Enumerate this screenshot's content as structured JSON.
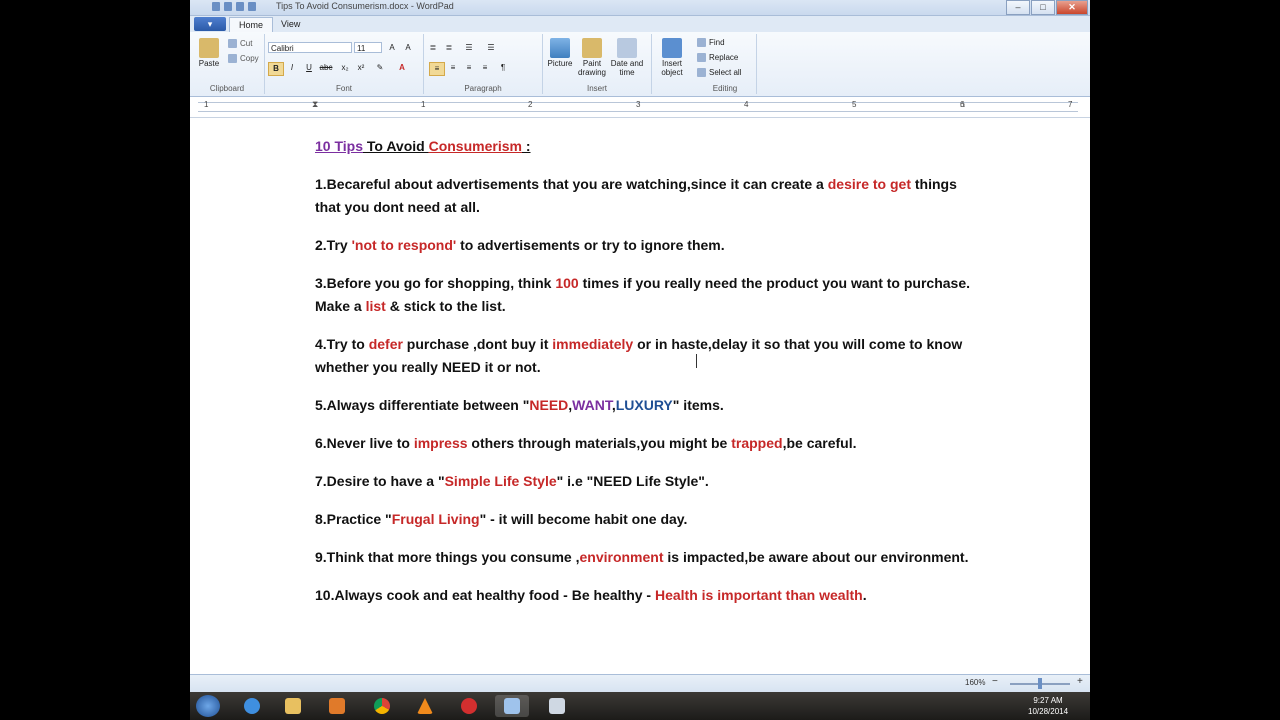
{
  "window": {
    "title": "Tips To Avoid Consumerism.docx - WordPad",
    "controls": {
      "minimize": "–",
      "maximize": "□",
      "close": "✕"
    }
  },
  "tabs": [
    {
      "label": "Home"
    },
    {
      "label": "View"
    }
  ],
  "ribbon": {
    "clipboard": {
      "label": "Clipboard",
      "paste": "Paste",
      "cut": "Cut",
      "copy": "Copy"
    },
    "font": {
      "label": "Font",
      "family": "Calibri",
      "size": "11",
      "bold": "B",
      "italic": "I",
      "underline": "U",
      "strike": "abc"
    },
    "paragraph": {
      "label": "Paragraph"
    },
    "insert": {
      "label": "Insert",
      "picture": "Picture",
      "paint1": "Paint",
      "paint2": "drawing",
      "date1": "Date and",
      "date2": "time",
      "object1": "Insert",
      "object2": "object"
    },
    "editing": {
      "label": "Editing",
      "find": "Find",
      "replace": "Replace",
      "select_all": "Select all"
    }
  },
  "ruler": {
    "numbers": [
      "1",
      "1",
      "2",
      "3",
      "4",
      "5",
      "6",
      "7"
    ]
  },
  "document": {
    "title_a": "10 Tips",
    "title_b": " To Avoid ",
    "title_c": "Consumerism",
    "title_d": " :",
    "p1a": "1.Becareful about advertisements that you are watching,since it can create a ",
    "p1b": "desire to get",
    "p1c": " things that you dont need at all.",
    "p2a": "2.Try ",
    "p2b": "'not to respond'",
    "p2c": " to advertisements or try to ignore them.",
    "p3a": "3.Before you go for shopping, think ",
    "p3b": "100",
    "p3c": " times if you really need the product you want to purchase. Make a ",
    "p3d": "list",
    "p3e": " & stick to the list.",
    "p4a": "4.Try to ",
    "p4b": "defer",
    "p4c": " purchase ,dont buy it ",
    "p4d": "immediately",
    "p4e": " or in haste,delay it so that you will come to know whether you really NEED it or not.",
    "p5a": "5.Always differentiate between \"",
    "p5b": "NEED",
    "p5c": ",",
    "p5d": "WANT",
    "p5e": ",",
    "p5f": "LUXURY",
    "p5g": "\" items.",
    "p6a": "6.Never live to ",
    "p6b": "impress",
    "p6c": " others through materials,you might be ",
    "p6d": "trapped",
    "p6e": ",be careful.",
    "p7a": "7.Desire to have a \"",
    "p7b": "Simple Life Style",
    "p7c": "\" i.e \"NEED Life Style\".",
    "p8a": "8.Practice \"",
    "p8b": "Frugal Living",
    "p8c": "\" - it will become habit one day.",
    "p9a": "9.Think that more things you consume ,",
    "p9b": "environment",
    "p9c": " is impacted,be aware about our environment.",
    "p10a": "10.Always cook and eat healthy food - Be healthy - ",
    "p10b": "Health is important than wealth",
    "p10c": "."
  },
  "status": {
    "zoom": "160%",
    "minus": "−",
    "plus": "+"
  },
  "taskbar": {
    "time": "9:27 AM",
    "date": "10/28/2014"
  },
  "colors": {
    "accent_red": "#c62828",
    "purple": "#7b2fa0",
    "blue": "#1f4f94"
  }
}
